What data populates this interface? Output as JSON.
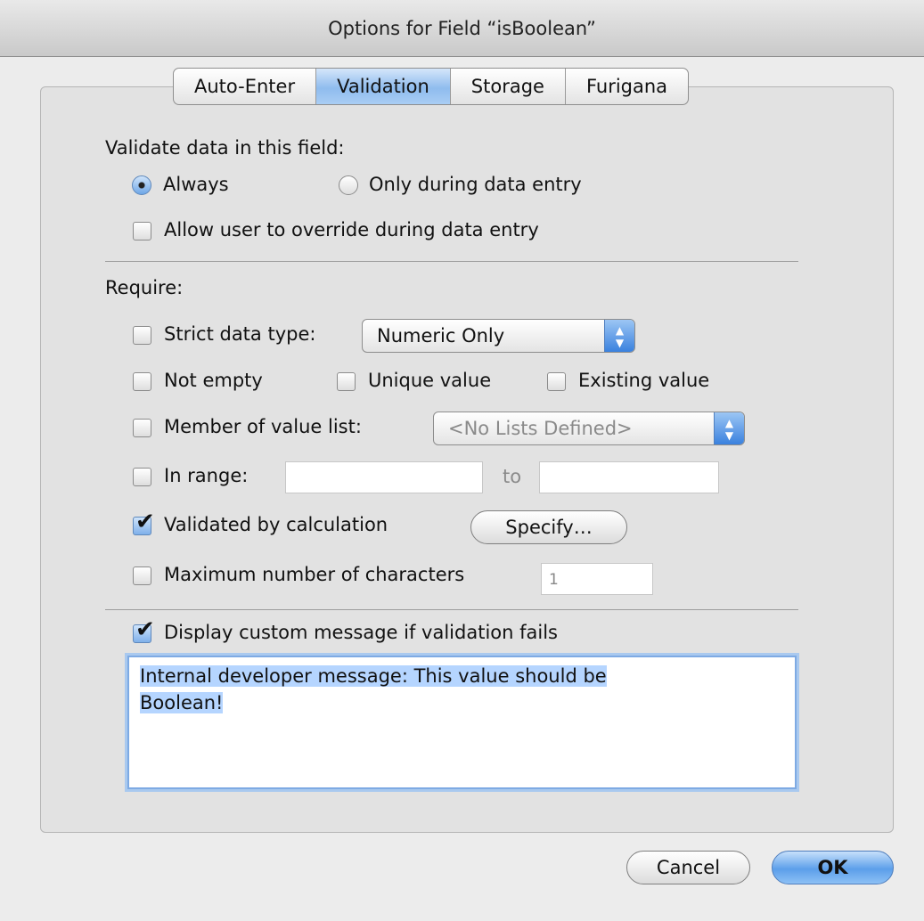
{
  "window": {
    "title": "Options for Field “isBoolean”"
  },
  "tabs": [
    {
      "label": "Auto-Enter",
      "selected": false
    },
    {
      "label": "Validation",
      "selected": true
    },
    {
      "label": "Storage",
      "selected": false
    },
    {
      "label": "Furigana",
      "selected": false
    }
  ],
  "validate": {
    "heading": "Validate data in this field:",
    "always_label": "Always",
    "always_checked": true,
    "entry_only_label": "Only during data entry",
    "entry_only_checked": false,
    "override_label": "Allow user to override during data entry",
    "override_checked": false
  },
  "require": {
    "heading": "Require:",
    "strict_label": "Strict data type:",
    "strict_checked": false,
    "strict_popup_value": "Numeric Only",
    "not_empty_label": "Not empty",
    "unique_label": "Unique value",
    "existing_label": "Existing value",
    "member_label": "Member of value list:",
    "member_popup_value": "<No Lists Defined>",
    "range_label": "In range:",
    "range_to_label": "to",
    "range_from_value": "",
    "range_to_value": "",
    "calc_label": "Validated by calculation",
    "calc_checked": true,
    "specify_label": "Specify…",
    "maxchars_label": "Maximum number of characters",
    "maxchars_value": "1"
  },
  "message": {
    "label": "Display custom message if validation fails",
    "checked": true,
    "line1": "Internal developer message: This value should be",
    "line2": "Boolean!"
  },
  "buttons": {
    "cancel": "Cancel",
    "ok": "OK"
  },
  "colors": {
    "accent": "#5c9fea",
    "selection": "#b5d5ff"
  },
  "icons": {
    "checkmark": "✔",
    "stepper_up": "▲",
    "stepper_down": "▼"
  }
}
